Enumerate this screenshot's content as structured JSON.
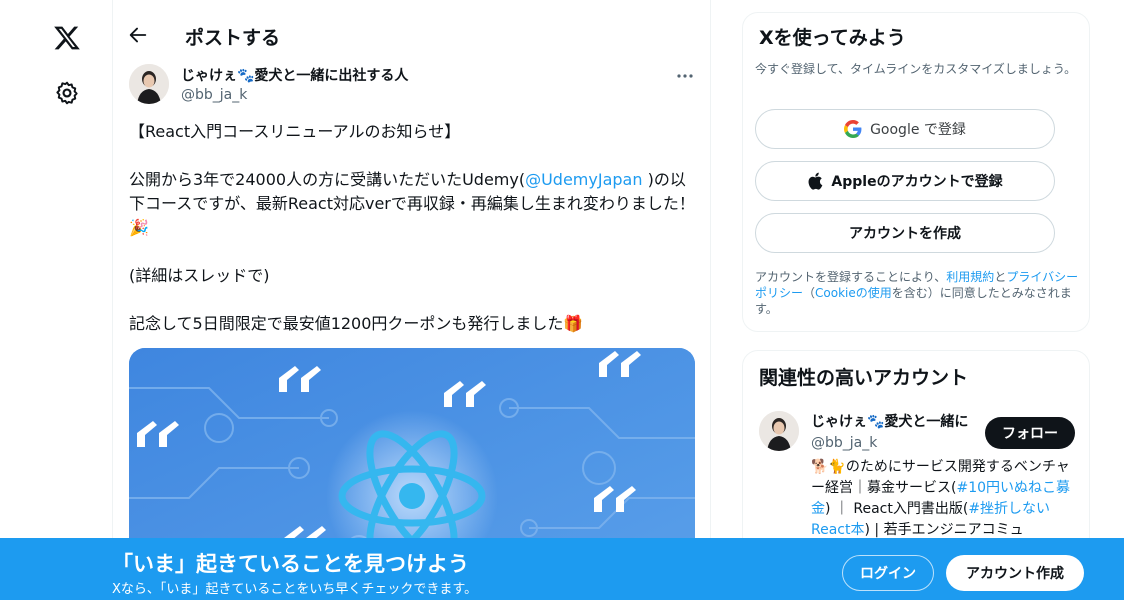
{
  "nav": {
    "logo_icon": "x-logo-icon",
    "settings_icon": "gear-icon"
  },
  "header": {
    "title": "ポストする",
    "back_icon": "arrow-left-icon"
  },
  "post": {
    "author_name": "じゃけぇ🐾愛犬と一緒に出社する人",
    "author_handle": "@bb_ja_k",
    "more_icon": "ellipsis-icon",
    "line1": "【React入門コースリニューアルのお知らせ】",
    "line2_before": "公開から3年で24000人の方に受講いただいたUdemy(",
    "mention": "@UdemyJapan",
    "line2_after": " )の以下コースですが、最新React対応verで再収録・再編集し生まれ変わりました！🎉",
    "line3": "(詳細はスレッドで)",
    "line4": "記念して5日間限定で最安値1200円クーポンも発行しました🎁",
    "media_alt": "React logo on blue circuit background"
  },
  "signup_card": {
    "title": "Xを使ってみよう",
    "subtitle": "今すぐ登録して、タイムラインをカスタマイズしましょう。",
    "google_label": "Google で登録",
    "apple_label": "Appleのアカウントで登録",
    "create_label": "アカウントを作成",
    "legal_prefix": "アカウントを登録することにより、",
    "legal_terms": "利用規約",
    "legal_and": "と",
    "legal_privacy": "プライバシーポリシー",
    "legal_cookie_open": "（",
    "legal_cookie": "Cookieの使用",
    "legal_suffix": "を含む）に同意したとみなされます。"
  },
  "related": {
    "title": "関連性の高いアカウント",
    "name": "じゃけぇ🐾愛犬と一緒に",
    "handle": "@bb_ja_k",
    "follow_label": "フォロー",
    "bio_1": "🐕🐈のためにサービス開発するベンチャー経営｜募金サービス(",
    "bio_tag1": "#10円いぬねこ募金",
    "bio_2": ") ｜ React入門書出版(",
    "bio_tag2": "#挫折しないReact本",
    "bio_3": ") | 若手エンジニアコミュ"
  },
  "banner": {
    "title": "「いま」起きていることを見つけよう",
    "subtitle": "Xなら、「いま」起きていることをいち早くチェックできます。",
    "login_label": "ログイン",
    "signup_label": "アカウント作成"
  },
  "colors": {
    "accent": "#1d9bf0",
    "text": "#0f1419",
    "muted": "#536471"
  }
}
